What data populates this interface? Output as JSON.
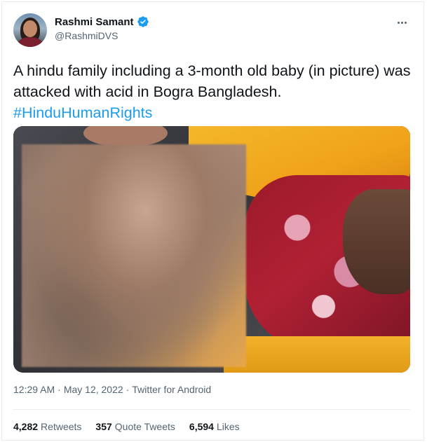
{
  "author": {
    "display_name": "Rashmi Samant",
    "handle": "@RashmiDVS",
    "verified": true
  },
  "tweet": {
    "text": "A hindu family including a 3-month old baby (in picture) was attacked with acid in Bogra Bangladesh.",
    "hashtag": "#HinduHumanRights"
  },
  "meta": {
    "time": "12:29 AM",
    "separator1": "·",
    "date": "May 12, 2022",
    "separator2": "·",
    "source": "Twitter for Android"
  },
  "stats": {
    "retweets_count": "4,282",
    "retweets_label": "Retweets",
    "quotes_count": "357",
    "quotes_label": "Quote Tweets",
    "likes_count": "6,594",
    "likes_label": "Likes"
  },
  "colors": {
    "accent": "#1d9bf0",
    "text": "#0f1419",
    "secondary": "#536471"
  },
  "icons": {
    "verified": "verified-badge-icon",
    "more": "more-options-icon"
  }
}
